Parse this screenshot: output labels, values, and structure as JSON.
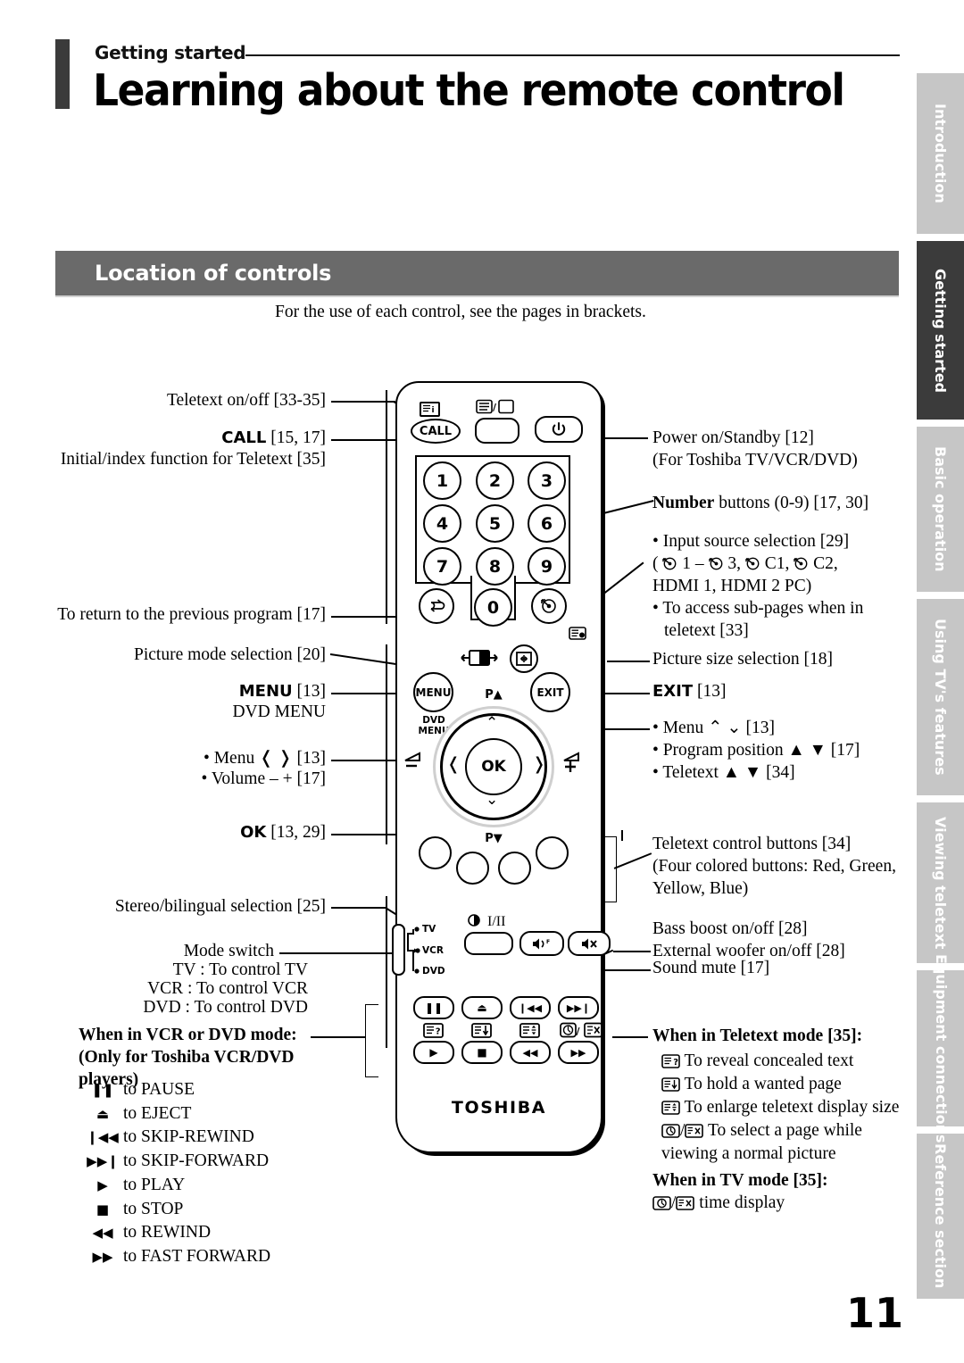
{
  "header": {
    "kicker": "Getting started",
    "title": "Learning about the remote control"
  },
  "section": {
    "band_label": "Location of controls",
    "intro": "For the use of each control, see the pages in brackets."
  },
  "sidebar": {
    "tabs": [
      {
        "label": "Introduction",
        "active": false
      },
      {
        "label": "Getting started",
        "active": true
      },
      {
        "label": "Basic operation",
        "active": false
      },
      {
        "label": "Using TV's features",
        "active": false
      },
      {
        "label": "Viewing teletext",
        "active": false
      },
      {
        "label": "Equipment connections",
        "active": false
      },
      {
        "label": "Reference section",
        "active": false
      }
    ]
  },
  "page_number": "11",
  "left_callouts": {
    "teletext_onoff": "Teletext on/off [33-35]",
    "call_bold": "CALL",
    "call_pages": " [15, 17]",
    "call_sub": "Initial/index function for Teletext [35]",
    "previous_program": "To return to the previous program [17]",
    "picture_mode": "Picture mode selection [20]",
    "menu_bold": "MENU",
    "menu_pages": " [13]",
    "dvd_menu": "DVD MENU",
    "menu_lr": "• Menu ❬ ❭ [13]",
    "volume": "• Volume – + [17]",
    "ok_bold": "OK",
    "ok_pages": " [13, 29]",
    "stereo": "Stereo/bilingual selection [25]",
    "mode_switch": "Mode switch",
    "mode_tv": "TV    : To control TV",
    "mode_vcr": "VCR : To control VCR",
    "mode_dvd": "DVD : To control DVD",
    "vcr_dvd_heading_1": "When in VCR or DVD mode:",
    "vcr_dvd_heading_2": "(Only for Toshiba VCR/DVD",
    "vcr_dvd_heading_3": "players)"
  },
  "vcr_functions": [
    {
      "glyph": "❚❚",
      "label": "to PAUSE"
    },
    {
      "glyph": "⏏",
      "label": "to EJECT"
    },
    {
      "glyph": "❙◀◀",
      "label": "to SKIP-REWIND"
    },
    {
      "glyph": "▶▶❙",
      "label": "to SKIP-FORWARD"
    },
    {
      "glyph": "▶",
      "label": "to PLAY"
    },
    {
      "glyph": "■",
      "label": "to STOP"
    },
    {
      "glyph": "◀◀",
      "label": "to REWIND"
    },
    {
      "glyph": "▶▶",
      "label": "to FAST FORWARD"
    }
  ],
  "right_callouts": {
    "power_1": "Power on/Standby [12]",
    "power_2": "(For Toshiba TV/VCR/DVD)",
    "number_bold": "Number",
    "number_rest": " buttons (0-9) [17, 30]",
    "input_1": "• Input source selection [29]",
    "input_2a": "( ",
    "input_2b": " 1 – ",
    "input_2c": " 3, ",
    "input_2d": " C1, ",
    "input_2e": " C2,",
    "input_3": "HDMI 1, HDMI 2 PC)",
    "input_4": "• To access sub-pages when in",
    "input_5": "teletext [33]",
    "picture_size": "Picture size selection [18]",
    "exit_bold": "EXIT",
    "exit_pages": " [13]",
    "menu_ud": "• Menu ⌃ ⌄ [13]",
    "program_pos": "• Program position ▲ ▼ [17]",
    "teletext_ud": "• Teletext ▲ ▼ [34]",
    "teletext_ctrl_1": "Teletext control buttons [34]",
    "teletext_ctrl_2": "(Four colored buttons: Red, Green,",
    "teletext_ctrl_3": "Yellow, Blue)",
    "bass_boost": "Bass boost on/off [28]",
    "ext_woofer": "External woofer on/off [28]",
    "sound_mute": "Sound mute [17]"
  },
  "teletext_mode": {
    "heading": "When in Teletext mode [35]:",
    "items": [
      {
        "icon": "reveal-icon",
        "label": "To reveal concealed text"
      },
      {
        "icon": "hold-icon",
        "label": "To hold a wanted page"
      },
      {
        "icon": "enlarge-icon",
        "label": "To enlarge teletext display size"
      }
    ],
    "select_line_1": "To select a page while",
    "select_line_2": "viewing a normal picture",
    "tv_heading": "When in TV mode [35]:",
    "tv_line": "time display"
  },
  "remote": {
    "brand": "TOSHIBA",
    "call_label": "CALL",
    "menu_label": "MENU",
    "dvd_menu_l1": "DVD",
    "dvd_menu_l2": "MENU",
    "exit_label": "EXIT",
    "ok_label": "OK",
    "p_up": "P▲",
    "p_down": "P▼",
    "stereo_label": "I/II",
    "mode_tv": "TV",
    "mode_vcr": "VCR",
    "mode_dvd": "DVD",
    "numbers": [
      "1",
      "2",
      "3",
      "4",
      "5",
      "6",
      "7",
      "8",
      "9"
    ],
    "zero": "0",
    "transport_row1": [
      "❚❚",
      "⏏",
      "❙◀◀",
      "▶▶❙"
    ],
    "transport_row2": [
      "▶",
      "■",
      "◀◀",
      "▶▶"
    ]
  },
  "colors": {
    "band": "#6a6a6a",
    "tab_inactive": "#c6c6c6",
    "tab_active": "#3b3b3b",
    "ink": "#000000"
  }
}
